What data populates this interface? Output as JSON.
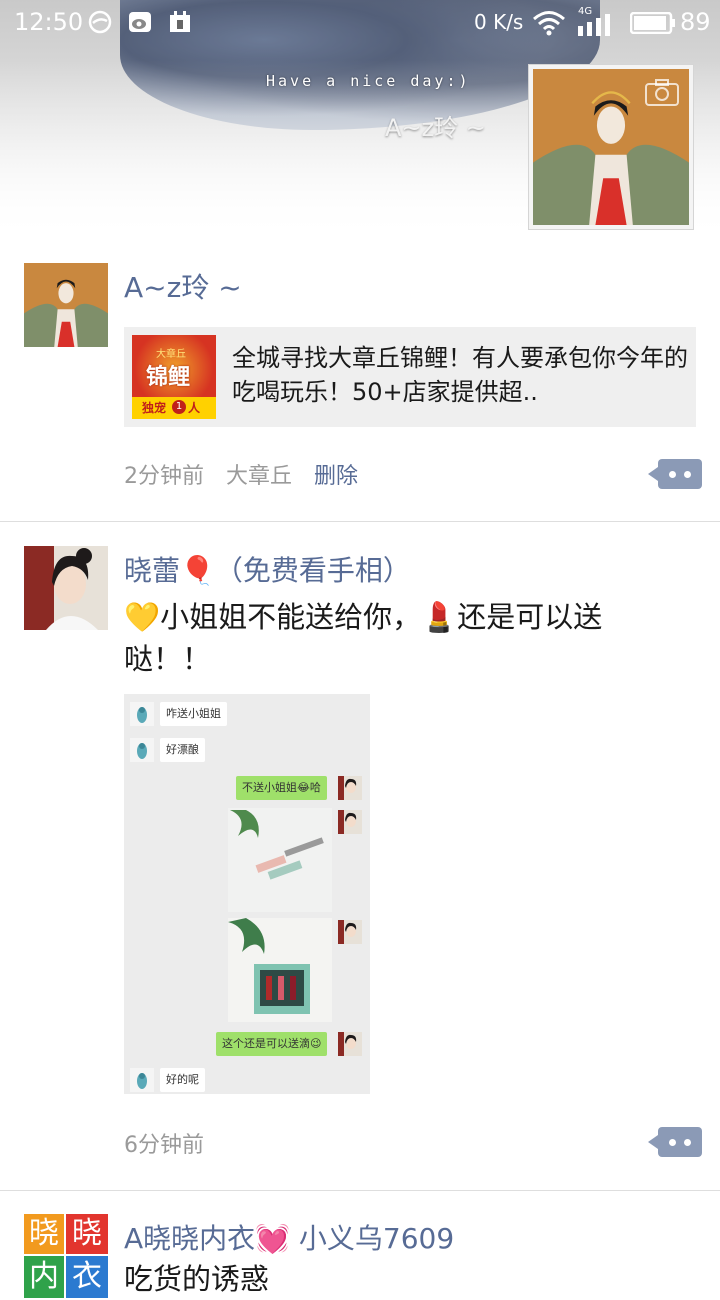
{
  "status_bar": {
    "time": "12:50",
    "net_speed": "0 K/s",
    "net_4g": "4G",
    "battery": "89"
  },
  "header": {
    "cover_caption": "Have a nice day:)",
    "cover_name": "A~z玲 ~"
  },
  "posts": [
    {
      "name": "A~z玲 ~",
      "link_title": "全城寻找大章丘锦鲤！有人要承包你今年的吃喝玩乐！50+店家提供超..",
      "link_thumb_top": "大章丘",
      "link_thumb_main": "锦鲤",
      "link_thumb_bottom": "独宠",
      "link_thumb_num": "1",
      "link_thumb_unit": "人",
      "time": "2分钟前",
      "location": "大章丘",
      "delete_label": "删除"
    },
    {
      "name": "晓蕾🎈（免费看手相）",
      "text": "💛小姐姐不能送给你，💄还是可以送哒！！",
      "chat": {
        "msg1": "咋送小姐姐",
        "msg2": "好漂酿",
        "msg3": "不送小姐姐😂哈",
        "msg4": "这个还是可以送滴😉",
        "msg5": "好的呢"
      },
      "time": "6分钟前"
    },
    {
      "name": "A晓晓内衣💓 小义乌7609",
      "avatar_chars": [
        "晓",
        "晓",
        "内",
        "衣"
      ],
      "text": "吃货的诱惑"
    }
  ],
  "colors": {
    "name_link": "#576b95",
    "meta": "#9a9a9a",
    "comment_button": "#8b9ab6"
  }
}
